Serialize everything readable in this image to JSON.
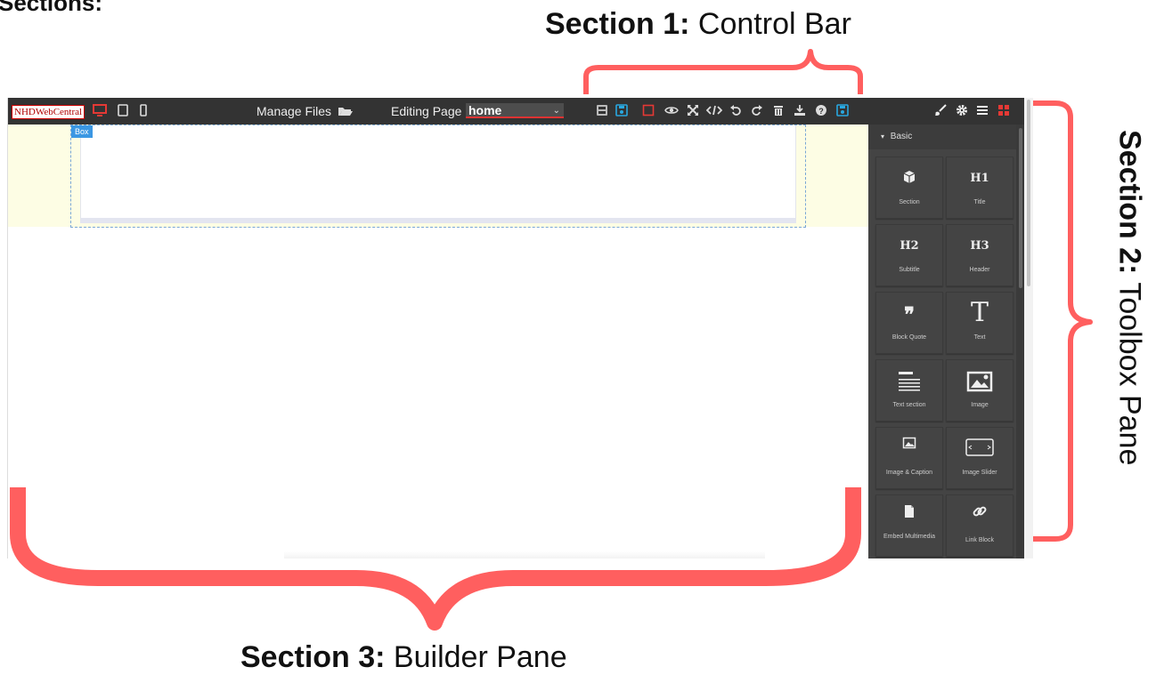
{
  "annotations": {
    "heading": "Sections:",
    "section1": {
      "bold": "Section 1:",
      "rest": " Control Bar"
    },
    "section2": {
      "bold": "Section 2:",
      "rest": " Toolbox Pane"
    },
    "section3": {
      "bold": "Section 3:",
      "rest": " Builder Pane"
    },
    "bracket_color": "#ff5f5f"
  },
  "control_bar": {
    "logo": "NHDWebCentral",
    "manage_files": "Manage Files",
    "editing_label": "Editing Page",
    "page_select": {
      "value": "home"
    },
    "device_icons": [
      "desktop-icon",
      "tablet-icon",
      "mobile-icon"
    ],
    "action_icons": [
      "import-icon",
      "save-icon",
      "outline-icon",
      "preview-eye-icon",
      "fullscreen-icon",
      "code-icon",
      "undo-icon",
      "redo-icon",
      "trash-icon",
      "download-icon",
      "help-icon",
      "save-page-icon"
    ],
    "accent_red": "#e53935",
    "accent_blue": "#29a8e0"
  },
  "builder": {
    "box_badge": "Box"
  },
  "toolbox": {
    "top_icons": [
      "brush-icon",
      "gear-icon",
      "menu-icon",
      "blocks-grid-icon"
    ],
    "category": "Basic",
    "blocks": [
      {
        "label": "Section",
        "icon": "cube-icon"
      },
      {
        "label": "Title",
        "icon": "h1-icon",
        "glyph": "H1"
      },
      {
        "label": "Subtitle",
        "icon": "h2-icon",
        "glyph": "H2"
      },
      {
        "label": "Header",
        "icon": "h3-icon",
        "glyph": "H3"
      },
      {
        "label": "Block Quote",
        "icon": "quote-icon",
        "glyph": "❞"
      },
      {
        "label": "Text",
        "icon": "text-icon",
        "glyph": "T"
      },
      {
        "label": "Text section",
        "icon": "text-section-icon"
      },
      {
        "label": "Image",
        "icon": "image-icon"
      },
      {
        "label": "Image & Caption",
        "icon": "image-caption-icon"
      },
      {
        "label": "Image Slider",
        "icon": "image-slider-icon"
      },
      {
        "label": "Embed Multimedia",
        "icon": "file-icon"
      },
      {
        "label": "Link Block",
        "icon": "link-icon"
      }
    ]
  }
}
